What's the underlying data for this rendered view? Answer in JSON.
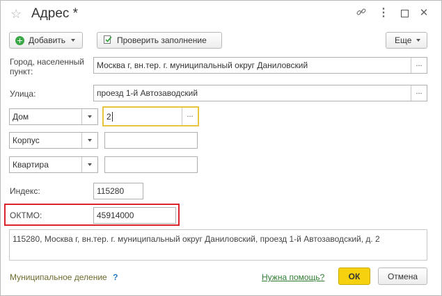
{
  "window": {
    "title": "Адрес *"
  },
  "toolbar": {
    "add_label": "Добавить",
    "check_label": "Проверить заполнение",
    "more_label": "Еще"
  },
  "fields": {
    "city": {
      "label": "Город, населенный пункт:",
      "value": "Москва г, вн.тер. г. муниципальный округ Даниловский"
    },
    "street": {
      "label": "Улица:",
      "value": "проезд 1-й Автозаводский"
    },
    "house": {
      "type": "Дом",
      "value": "2"
    },
    "building": {
      "type": "Корпус",
      "value": ""
    },
    "apartment": {
      "type": "Квартира",
      "value": ""
    },
    "index": {
      "label": "Индекс:",
      "value": "115280"
    },
    "oktmo": {
      "label": "ОКТМО:",
      "value": "45914000"
    }
  },
  "address_full": "115280, Москва г, вн.тер. г. муниципальный округ Даниловский, проезд 1-й Автозаводский, д. 2",
  "footer": {
    "municipal_link": "Муниципальное деление",
    "question_mark": "?",
    "help_link": "Нужна помощь?",
    "ok_label": "ОК",
    "cancel_label": "Отмена"
  },
  "icons": {
    "dots": "...",
    "more_vert": "⋮",
    "link": "🔗",
    "star": "☆",
    "maximize": "□",
    "close": "✕"
  },
  "colors": {
    "ok_bg": "#f5d10f",
    "focus_border": "#e8c440",
    "highlight_red": "#d9232d",
    "link_green": "#2e7d32",
    "add_icon_green": "#3aa845"
  }
}
